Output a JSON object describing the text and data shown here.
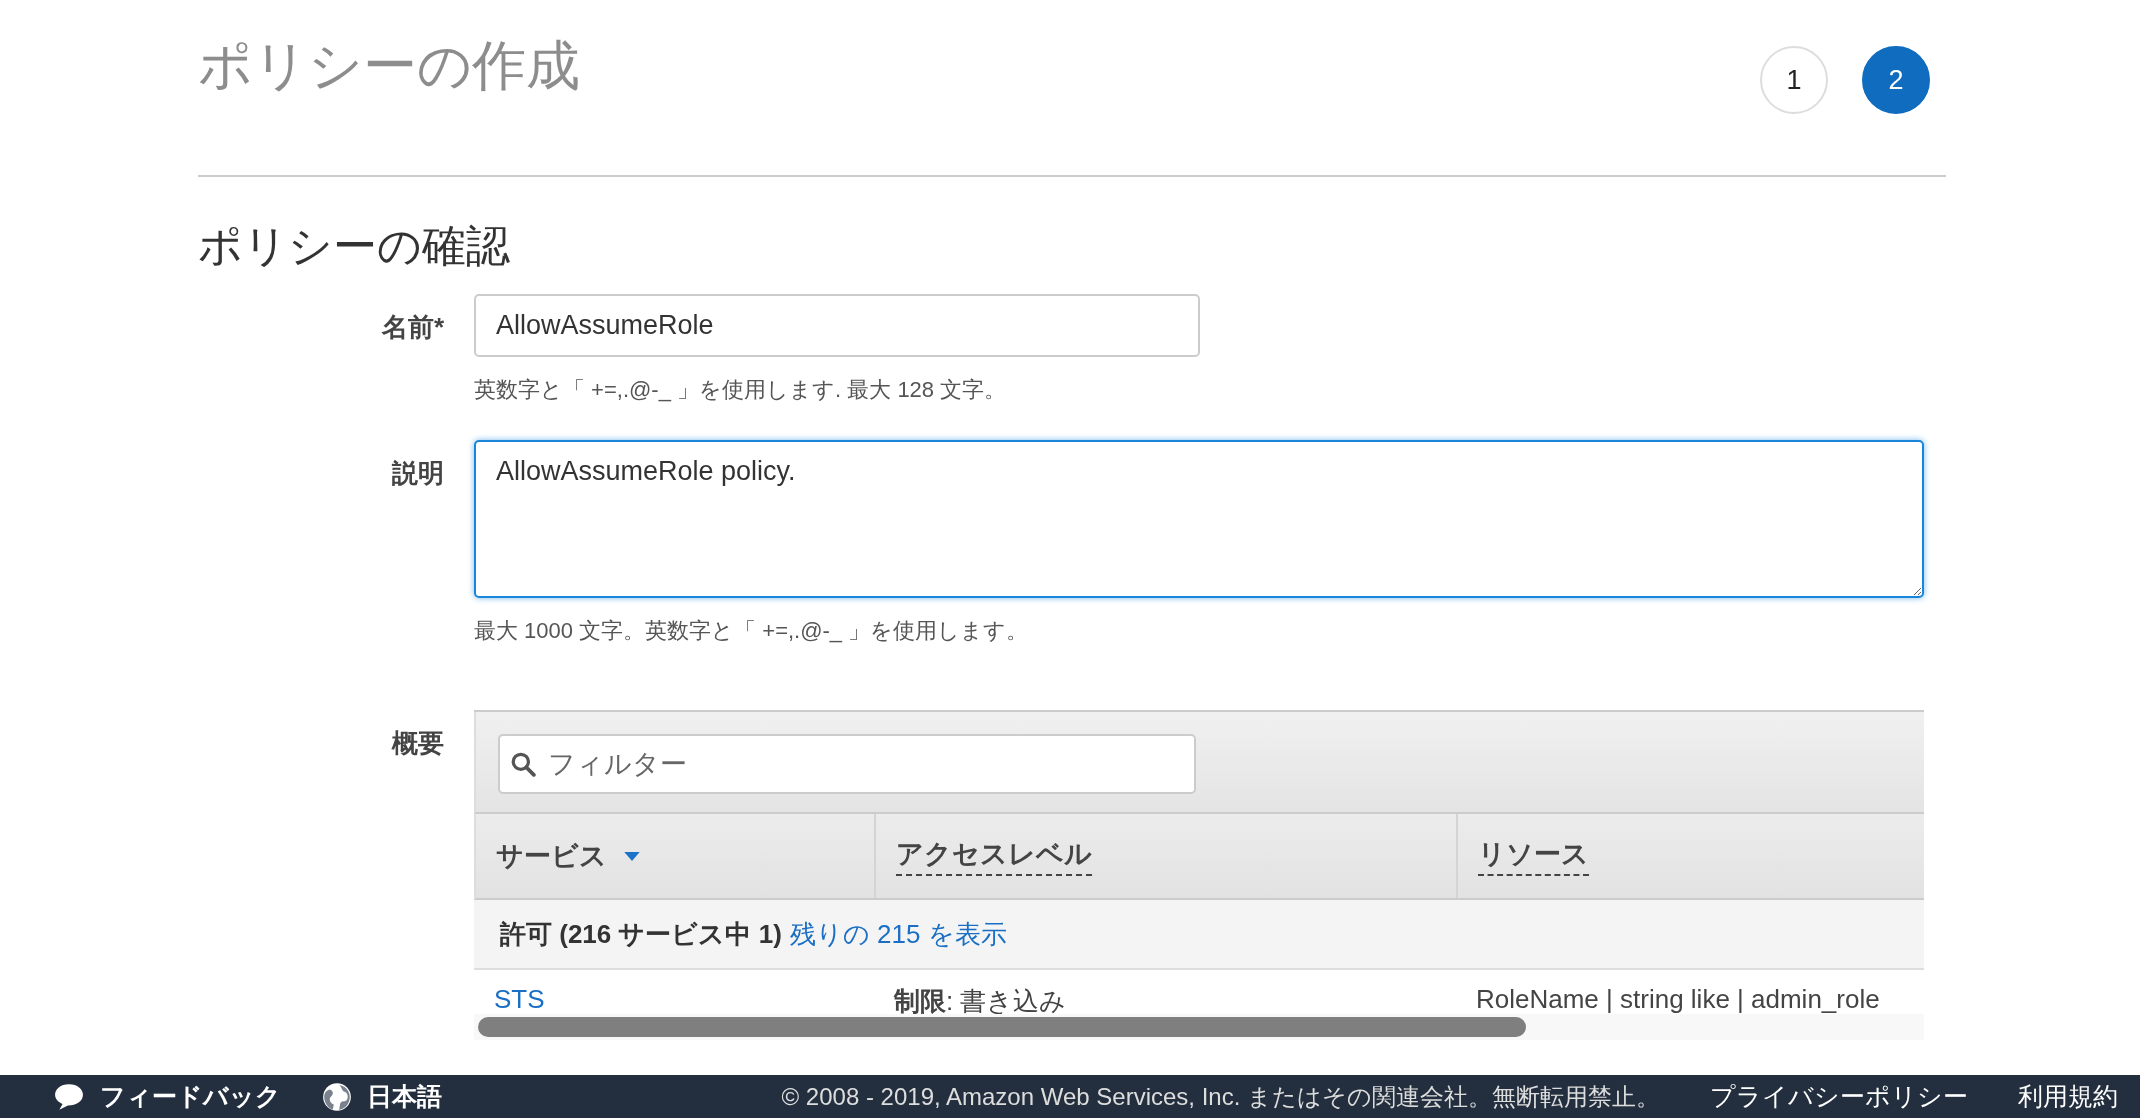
{
  "page_title": "ポリシーの作成",
  "steps": [
    {
      "label": "1",
      "selected": false
    },
    {
      "label": "2",
      "selected": true
    }
  ],
  "section_title": "ポリシーの確認",
  "name_field": {
    "label": "名前*",
    "value": "AllowAssumeRole",
    "hint": "英数字と「 +=,.@-_ 」を使用します. 最大 128 文字。"
  },
  "description_field": {
    "label": "説明",
    "value": "AllowAssumeRole policy.",
    "hint": "最大 1000 文字。英数字と「 +=,.@-_ 」を使用します。",
    "focused": true
  },
  "summary": {
    "label": "概要",
    "filter": {
      "placeholder": "フィルター"
    },
    "columns": [
      {
        "label": "サービス",
        "sorted": true,
        "dashed": false
      },
      {
        "label": "アクセスレベル",
        "sorted": false,
        "dashed": true
      },
      {
        "label": "リソース",
        "sorted": false,
        "dashed": true
      }
    ],
    "group": {
      "label": "許可 (216 サービス中 1)",
      "link": "残りの 215 を表示"
    },
    "rows": [
      {
        "service": "STS",
        "access_level": "**制限**: 書き込み",
        "resource": "RoleName | string like | admin_role"
      }
    ]
  },
  "footer": {
    "feedback": "フィードバック",
    "language": "日本語",
    "copyright": "© 2008 - 2019, Amazon Web Services, Inc. またはその関連会社。無断転用禁止。",
    "links": [
      "プライバシーポリシー",
      "利用規約"
    ]
  }
}
